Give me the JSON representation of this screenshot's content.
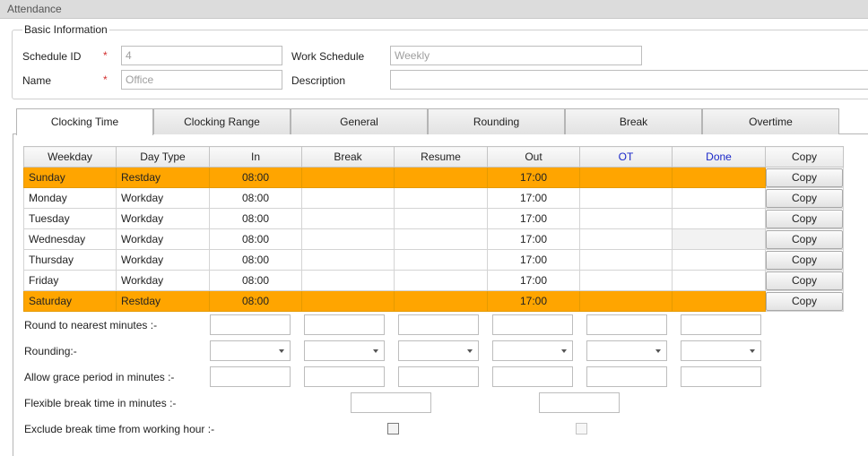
{
  "window": {
    "title": "Attendance"
  },
  "basic_info": {
    "legend": "Basic Information",
    "schedule_id": {
      "label": "Schedule ID",
      "required": "*",
      "value": "4"
    },
    "name": {
      "label": "Name",
      "required": "*",
      "value": "Office"
    },
    "work_schedule": {
      "label": "Work Schedule",
      "value": "Weekly"
    },
    "description": {
      "label": "Description",
      "value": ""
    }
  },
  "tabs": [
    {
      "label": "Clocking Time",
      "active": true
    },
    {
      "label": "Clocking Range"
    },
    {
      "label": "General"
    },
    {
      "label": "Rounding"
    },
    {
      "label": "Break"
    },
    {
      "label": "Overtime"
    }
  ],
  "grid": {
    "columns": [
      "Weekday",
      "Day Type",
      "In",
      "Break",
      "Resume",
      "Out",
      "OT",
      "Done",
      "Copy"
    ],
    "highlight_color": "#ffa500",
    "rows": [
      {
        "weekday": "Sunday",
        "day_type": "Restday",
        "in": "08:00",
        "break": "",
        "resume": "",
        "out": "17:00",
        "ot": "",
        "done": "",
        "copy": "Copy",
        "rest": true
      },
      {
        "weekday": "Monday",
        "day_type": "Workday",
        "in": "08:00",
        "break": "",
        "resume": "",
        "out": "17:00",
        "ot": "",
        "done": "",
        "copy": "Copy"
      },
      {
        "weekday": "Tuesday",
        "day_type": "Workday",
        "in": "08:00",
        "break": "",
        "resume": "",
        "out": "17:00",
        "ot": "",
        "done": "",
        "copy": "Copy"
      },
      {
        "weekday": "Wednesday",
        "day_type": "Workday",
        "in": "08:00",
        "break": "",
        "resume": "",
        "out": "17:00",
        "ot": "",
        "done": "",
        "copy": "Copy"
      },
      {
        "weekday": "Thursday",
        "day_type": "Workday",
        "in": "08:00",
        "break": "",
        "resume": "",
        "out": "17:00",
        "ot": "",
        "done": "",
        "copy": "Copy"
      },
      {
        "weekday": "Friday",
        "day_type": "Workday",
        "in": "08:00",
        "break": "",
        "resume": "",
        "out": "17:00",
        "ot": "",
        "done": "",
        "copy": "Copy"
      },
      {
        "weekday": "Saturday",
        "day_type": "Restday",
        "in": "08:00",
        "break": "",
        "resume": "",
        "out": "17:00",
        "ot": "",
        "done": "",
        "copy": "Copy",
        "rest": true
      }
    ]
  },
  "settings": {
    "round_minutes": {
      "label": "Round to nearest minutes :-"
    },
    "rounding": {
      "label": "Rounding:-"
    },
    "grace_period": {
      "label": "Allow grace period in minutes :-"
    },
    "flexible_break": {
      "label": "Flexible break time in minutes :-"
    },
    "exclude_break": {
      "label": "Exclude break time from working hour :-"
    }
  }
}
